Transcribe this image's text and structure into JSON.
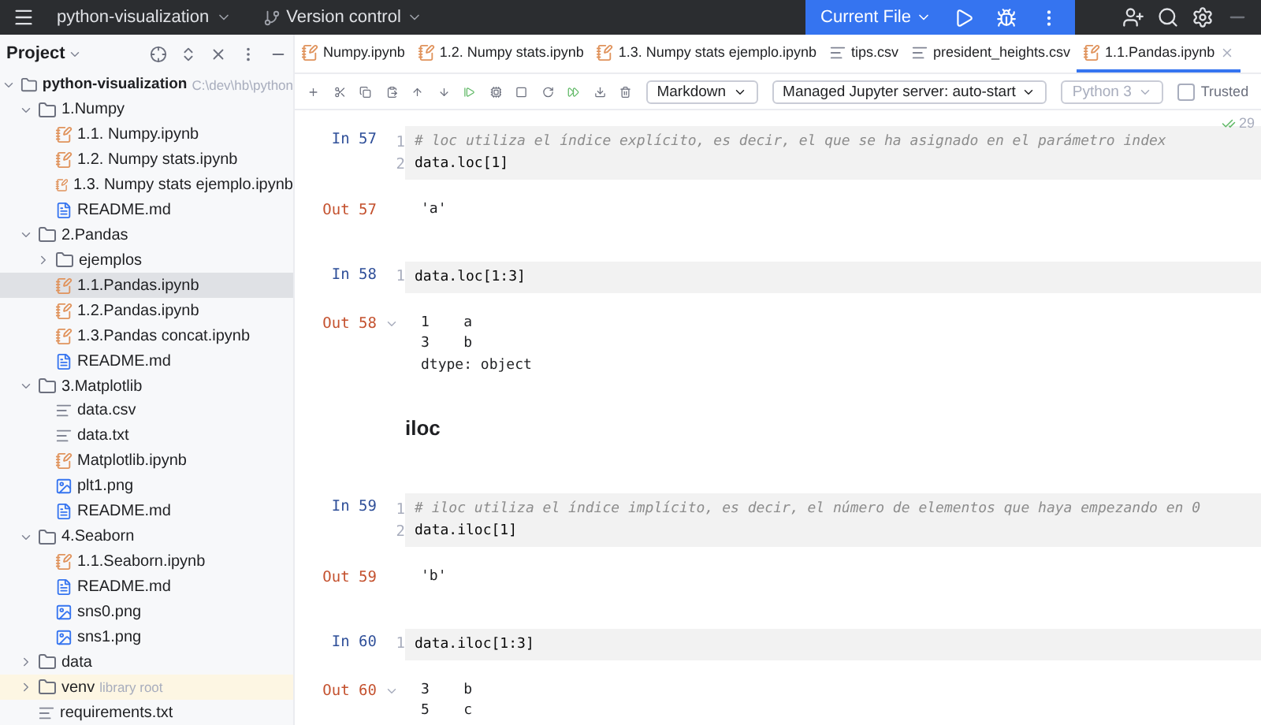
{
  "title_bar": {
    "project": "python-visualization",
    "vcs": "Version control",
    "run_config": "Current File"
  },
  "sidebar": {
    "title": "Project",
    "tree": [
      {
        "label": "python-visualization",
        "path": "C:\\dev\\hb\\python",
        "kind": "root",
        "expanded": true,
        "selected": false,
        "children": [
          {
            "label": "1.Numpy",
            "kind": "folder",
            "expanded": true,
            "selected": false,
            "children": [
              {
                "label": "1.1. Numpy.ipynb",
                "kind": "notebook",
                "selected": false
              },
              {
                "label": "1.2. Numpy stats.ipynb",
                "kind": "notebook",
                "selected": false
              },
              {
                "label": "1.3. Numpy stats ejemplo.ipynb",
                "kind": "notebook",
                "selected": false
              },
              {
                "label": "README.md",
                "kind": "markdown",
                "selected": false
              }
            ]
          },
          {
            "label": "2.Pandas",
            "kind": "folder",
            "expanded": true,
            "selected": false,
            "children": [
              {
                "label": "ejemplos",
                "kind": "folder",
                "expanded": false,
                "selected": false
              },
              {
                "label": "1.1.Pandas.ipynb",
                "kind": "notebook",
                "selected": true
              },
              {
                "label": "1.2.Pandas.ipynb",
                "kind": "notebook",
                "selected": false
              },
              {
                "label": "1.3.Pandas concat.ipynb",
                "kind": "notebook",
                "selected": false
              },
              {
                "label": "README.md",
                "kind": "markdown",
                "selected": false
              }
            ]
          },
          {
            "label": "3.Matplotlib",
            "kind": "folder",
            "expanded": true,
            "selected": false,
            "children": [
              {
                "label": "data.csv",
                "kind": "text",
                "selected": false
              },
              {
                "label": "data.txt",
                "kind": "text",
                "selected": false
              },
              {
                "label": "Matplotlib.ipynb",
                "kind": "notebook",
                "selected": false
              },
              {
                "label": "plt1.png",
                "kind": "image",
                "selected": false
              },
              {
                "label": "README.md",
                "kind": "markdown",
                "selected": false
              }
            ]
          },
          {
            "label": "4.Seaborn",
            "kind": "folder",
            "expanded": true,
            "selected": false,
            "children": [
              {
                "label": "1.1.Seaborn.ipynb",
                "kind": "notebook",
                "selected": false
              },
              {
                "label": "README.md",
                "kind": "markdown",
                "selected": false
              },
              {
                "label": "sns0.png",
                "kind": "image",
                "selected": false
              },
              {
                "label": "sns1.png",
                "kind": "image",
                "selected": false
              }
            ]
          },
          {
            "label": "data",
            "kind": "folder",
            "expanded": false,
            "selected": false
          },
          {
            "label": "venv",
            "note": "library root",
            "kind": "library",
            "expanded": false,
            "selected": false
          },
          {
            "label": "requirements.txt",
            "kind": "text",
            "selected": false
          }
        ]
      }
    ]
  },
  "tabs": [
    {
      "label": "Numpy.ipynb",
      "kind": "notebook",
      "selected": false
    },
    {
      "label": "1.2. Numpy stats.ipynb",
      "kind": "notebook",
      "selected": false
    },
    {
      "label": "1.3. Numpy stats ejemplo.ipynb",
      "kind": "notebook",
      "selected": false
    },
    {
      "label": "tips.csv",
      "kind": "text",
      "selected": false
    },
    {
      "label": "president_heights.csv",
      "kind": "text",
      "selected": false
    },
    {
      "label": "1.1.Pandas.ipynb",
      "kind": "notebook",
      "selected": true
    }
  ],
  "toolbar": {
    "cell_type": "Markdown",
    "server": "Managed Jupyter server: auto-start",
    "kernel": "Python 3",
    "trusted": {
      "label": "Trusted",
      "checked": false
    }
  },
  "inspection_count": "29",
  "cells": [
    {
      "kind": "code",
      "prompt": "In 57",
      "lines": [
        {
          "no": "1",
          "kind": "comment",
          "text": "# loc utiliza el índice explícito, es decir, el que se ha asignado en el parámetro index"
        },
        {
          "no": "2",
          "kind": "code",
          "text": "data.loc[1]"
        }
      ]
    },
    {
      "kind": "output",
      "prompt": "Out 57",
      "collapsible": false,
      "lines": [
        "'a'"
      ]
    },
    {
      "kind": "code",
      "prompt": "In 58",
      "lines": [
        {
          "no": "1",
          "kind": "code",
          "text": "data.loc[1:3]"
        }
      ]
    },
    {
      "kind": "output",
      "prompt": "Out 58",
      "collapsible": true,
      "lines": [
        "1    a",
        "3    b",
        "dtype: object"
      ]
    },
    {
      "kind": "heading",
      "text": "iloc"
    },
    {
      "kind": "code",
      "prompt": "In 59",
      "lines": [
        {
          "no": "1",
          "kind": "comment",
          "text": "# iloc utiliza el índice implícito, es decir, el número de elementos que haya empezando en 0"
        },
        {
          "no": "2",
          "kind": "code",
          "text": "data.iloc[1]"
        }
      ]
    },
    {
      "kind": "output",
      "prompt": "Out 59",
      "collapsible": false,
      "lines": [
        "'b'"
      ]
    },
    {
      "kind": "code",
      "prompt": "In 60",
      "lines": [
        {
          "no": "1",
          "kind": "code",
          "text": "data.iloc[1:3]"
        }
      ]
    },
    {
      "kind": "output",
      "prompt": "Out 60",
      "collapsible": true,
      "lines": [
        "3    b",
        "5    c"
      ]
    }
  ]
}
